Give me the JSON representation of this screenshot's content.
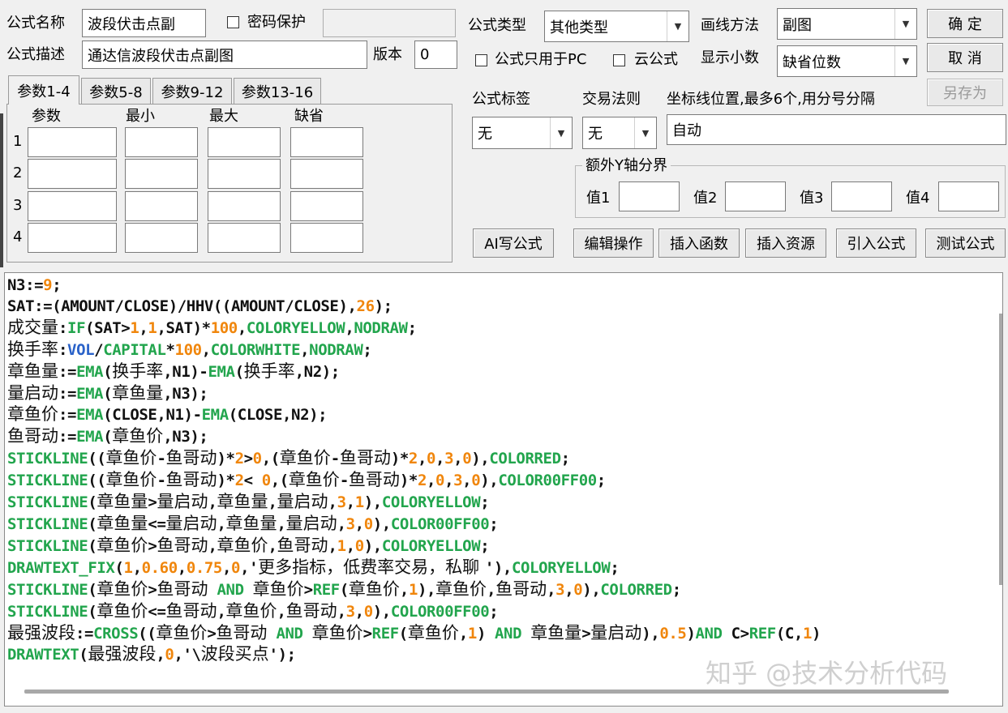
{
  "formula": {
    "name_label": "公式名称",
    "name_value": "波段伏击点副",
    "password_label": "密码保护",
    "desc_label": "公式描述",
    "desc_value": "通达信波段伏击点副图",
    "version_label": "版本",
    "version_value": "0",
    "type_label": "公式类型",
    "type_value": "其他类型",
    "draw_label": "画线方法",
    "draw_value": "副图",
    "pc_only_label": "公式只用于PC",
    "cloud_label": "云公式",
    "decimal_label": "显示小数",
    "decimal_value": "缺省位数",
    "tag_label": "公式标签",
    "tag_value": "无",
    "rule_label": "交易法则",
    "rule_value": "无",
    "coord_label": "坐标线位置,最多6个,用分号分隔",
    "coord_value": "自动",
    "y_group_label": "额外Y轴分界",
    "y_values": [
      "值1",
      "值2",
      "值3",
      "值4"
    ]
  },
  "buttons": {
    "ok": "确  定",
    "cancel": "取  消",
    "save_as": "另存为",
    "ai": "AI写公式",
    "edit": "编辑操作",
    "insert_func": "插入函数",
    "insert_res": "插入资源",
    "import": "引入公式",
    "test": "测试公式"
  },
  "tabs": [
    "参数1-4",
    "参数5-8",
    "参数9-12",
    "参数13-16"
  ],
  "params": {
    "headers": [
      "参数",
      "最小",
      "最大",
      "缺省"
    ],
    "rows": [
      "1",
      "2",
      "3",
      "4"
    ]
  },
  "watermark": "知乎 @技术分析代码",
  "colors": {
    "keyword": "#22a54d",
    "number": "#f0860c",
    "variable": "#2a62c9",
    "text": "#111111"
  },
  "code_lines": [
    [
      [
        "d",
        "N3:="
      ],
      [
        "o",
        "9"
      ],
      [
        "d",
        ";"
      ]
    ],
    [
      [
        "d",
        "SAT:=(AMOUNT/CLOSE)/HHV((AMOUNT/CLOSE),"
      ],
      [
        "o",
        "26"
      ],
      [
        "d",
        ");"
      ]
    ],
    [
      [
        "c",
        "成交量"
      ],
      [
        "d",
        ":"
      ],
      [
        "g",
        "IF"
      ],
      [
        "d",
        "(SAT>"
      ],
      [
        "o",
        "1"
      ],
      [
        "d",
        ","
      ],
      [
        "o",
        "1"
      ],
      [
        "d",
        ",SAT)*"
      ],
      [
        "o",
        "100"
      ],
      [
        "d",
        ","
      ],
      [
        "g",
        "COLORYELLOW"
      ],
      [
        "d",
        ","
      ],
      [
        "g",
        "NODRAW"
      ],
      [
        "d",
        ";"
      ]
    ],
    [
      [
        "c",
        "换手率"
      ],
      [
        "d",
        ":"
      ],
      [
        "b",
        "VOL"
      ],
      [
        "d",
        "/"
      ],
      [
        "g",
        "CAPITAL"
      ],
      [
        "d",
        "*"
      ],
      [
        "o",
        "100"
      ],
      [
        "d",
        ","
      ],
      [
        "g",
        "COLORWHITE"
      ],
      [
        "d",
        ","
      ],
      [
        "g",
        "NODRAW"
      ],
      [
        "d",
        ";"
      ]
    ],
    [
      [
        "c",
        "章鱼量"
      ],
      [
        "d",
        ":="
      ],
      [
        "g",
        "EMA"
      ],
      [
        "d",
        "("
      ],
      [
        "c",
        "换手率"
      ],
      [
        "d",
        ",N1)-"
      ],
      [
        "g",
        "EMA"
      ],
      [
        "d",
        "("
      ],
      [
        "c",
        "换手率"
      ],
      [
        "d",
        ",N2);"
      ]
    ],
    [
      [
        "c",
        "量启动"
      ],
      [
        "d",
        ":="
      ],
      [
        "g",
        "EMA"
      ],
      [
        "d",
        "("
      ],
      [
        "c",
        "章鱼量"
      ],
      [
        "d",
        ",N3);"
      ]
    ],
    [
      [
        "c",
        "章鱼价"
      ],
      [
        "d",
        ":="
      ],
      [
        "g",
        "EMA"
      ],
      [
        "d",
        "(CLOSE,N1)-"
      ],
      [
        "g",
        "EMA"
      ],
      [
        "d",
        "(CLOSE,N2);"
      ]
    ],
    [
      [
        "c",
        "鱼哥动"
      ],
      [
        "d",
        ":="
      ],
      [
        "g",
        "EMA"
      ],
      [
        "d",
        "("
      ],
      [
        "c",
        "章鱼价"
      ],
      [
        "d",
        ",N3);"
      ]
    ],
    [
      [
        "g",
        "STICKLINE"
      ],
      [
        "d",
        "(("
      ],
      [
        "c",
        "章鱼价"
      ],
      [
        "d",
        "-"
      ],
      [
        "c",
        "鱼哥动"
      ],
      [
        "d",
        ")*"
      ],
      [
        "o",
        "2"
      ],
      [
        "d",
        ">"
      ],
      [
        "o",
        "0"
      ],
      [
        "d",
        ",("
      ],
      [
        "c",
        "章鱼价"
      ],
      [
        "d",
        "-"
      ],
      [
        "c",
        "鱼哥动"
      ],
      [
        "d",
        ")*"
      ],
      [
        "o",
        "2"
      ],
      [
        "d",
        ","
      ],
      [
        "o",
        "0"
      ],
      [
        "d",
        ","
      ],
      [
        "o",
        "3"
      ],
      [
        "d",
        ","
      ],
      [
        "o",
        "0"
      ],
      [
        "d",
        "),"
      ],
      [
        "g",
        "COLORRED"
      ],
      [
        "d",
        ";"
      ]
    ],
    [
      [
        "g",
        "STICKLINE"
      ],
      [
        "d",
        "(("
      ],
      [
        "c",
        "章鱼价"
      ],
      [
        "d",
        "-"
      ],
      [
        "c",
        "鱼哥动"
      ],
      [
        "d",
        ")*"
      ],
      [
        "o",
        "2"
      ],
      [
        "d",
        "< "
      ],
      [
        "o",
        "0"
      ],
      [
        "d",
        ",("
      ],
      [
        "c",
        "章鱼价"
      ],
      [
        "d",
        "-"
      ],
      [
        "c",
        "鱼哥动"
      ],
      [
        "d",
        ")*"
      ],
      [
        "o",
        "2"
      ],
      [
        "d",
        ","
      ],
      [
        "o",
        "0"
      ],
      [
        "d",
        ","
      ],
      [
        "o",
        "3"
      ],
      [
        "d",
        ","
      ],
      [
        "o",
        "0"
      ],
      [
        "d",
        "),"
      ],
      [
        "g",
        "COLOR00FF00"
      ],
      [
        "d",
        ";"
      ]
    ],
    [
      [
        "g",
        "STICKLINE"
      ],
      [
        "d",
        "("
      ],
      [
        "c",
        "章鱼量"
      ],
      [
        "d",
        ">"
      ],
      [
        "c",
        "量启动"
      ],
      [
        "d",
        ","
      ],
      [
        "c",
        "章鱼量"
      ],
      [
        "d",
        ","
      ],
      [
        "c",
        "量启动"
      ],
      [
        "d",
        ","
      ],
      [
        "o",
        "3"
      ],
      [
        "d",
        ","
      ],
      [
        "o",
        "1"
      ],
      [
        "d",
        "),"
      ],
      [
        "g",
        "COLORYELLOW"
      ],
      [
        "d",
        ";"
      ]
    ],
    [
      [
        "g",
        "STICKLINE"
      ],
      [
        "d",
        "("
      ],
      [
        "c",
        "章鱼量"
      ],
      [
        "d",
        "<="
      ],
      [
        "c",
        "量启动"
      ],
      [
        "d",
        ","
      ],
      [
        "c",
        "章鱼量"
      ],
      [
        "d",
        ","
      ],
      [
        "c",
        "量启动"
      ],
      [
        "d",
        ","
      ],
      [
        "o",
        "3"
      ],
      [
        "d",
        ","
      ],
      [
        "o",
        "0"
      ],
      [
        "d",
        "),"
      ],
      [
        "g",
        "COLOR00FF00"
      ],
      [
        "d",
        ";"
      ]
    ],
    [
      [
        "g",
        "STICKLINE"
      ],
      [
        "d",
        "("
      ],
      [
        "c",
        "章鱼价"
      ],
      [
        "d",
        ">"
      ],
      [
        "c",
        "鱼哥动"
      ],
      [
        "d",
        ","
      ],
      [
        "c",
        "章鱼价"
      ],
      [
        "d",
        ","
      ],
      [
        "c",
        "鱼哥动"
      ],
      [
        "d",
        ","
      ],
      [
        "o",
        "1"
      ],
      [
        "d",
        ","
      ],
      [
        "o",
        "0"
      ],
      [
        "d",
        "),"
      ],
      [
        "g",
        "COLORYELLOW"
      ],
      [
        "d",
        ";"
      ]
    ],
    [
      [
        "g",
        "DRAWTEXT_FIX"
      ],
      [
        "d",
        "("
      ],
      [
        "o",
        "1"
      ],
      [
        "d",
        ","
      ],
      [
        "o",
        "0.60"
      ],
      [
        "d",
        ","
      ],
      [
        "o",
        "0.75"
      ],
      [
        "d",
        ","
      ],
      [
        "o",
        "0"
      ],
      [
        "d",
        ",'"
      ],
      [
        "c",
        "更多指标，低费率交易，私聊 "
      ],
      [
        "d",
        "'),"
      ],
      [
        "g",
        "COLORYELLOW"
      ],
      [
        "d",
        ";"
      ]
    ],
    [
      [
        "g",
        "STICKLINE"
      ],
      [
        "d",
        "("
      ],
      [
        "c",
        "章鱼价"
      ],
      [
        "d",
        ">"
      ],
      [
        "c",
        "鱼哥动"
      ],
      [
        "d",
        " "
      ],
      [
        "g",
        "AND"
      ],
      [
        "d",
        " "
      ],
      [
        "c",
        "章鱼价"
      ],
      [
        "d",
        ">"
      ],
      [
        "g",
        "REF"
      ],
      [
        "d",
        "("
      ],
      [
        "c",
        "章鱼价"
      ],
      [
        "d",
        ","
      ],
      [
        "o",
        "1"
      ],
      [
        "d",
        "),"
      ],
      [
        "c",
        "章鱼价"
      ],
      [
        "d",
        ","
      ],
      [
        "c",
        "鱼哥动"
      ],
      [
        "d",
        ","
      ],
      [
        "o",
        "3"
      ],
      [
        "d",
        ","
      ],
      [
        "o",
        "0"
      ],
      [
        "d",
        "),"
      ],
      [
        "g",
        "COLORRED"
      ],
      [
        "d",
        ";"
      ]
    ],
    [
      [
        "g",
        "STICKLINE"
      ],
      [
        "d",
        "("
      ],
      [
        "c",
        "章鱼价"
      ],
      [
        "d",
        "<="
      ],
      [
        "c",
        "鱼哥动"
      ],
      [
        "d",
        ","
      ],
      [
        "c",
        "章鱼价"
      ],
      [
        "d",
        ","
      ],
      [
        "c",
        "鱼哥动"
      ],
      [
        "d",
        ","
      ],
      [
        "o",
        "3"
      ],
      [
        "d",
        ","
      ],
      [
        "o",
        "0"
      ],
      [
        "d",
        "),"
      ],
      [
        "g",
        "COLOR00FF00"
      ],
      [
        "d",
        ";"
      ]
    ],
    [
      [
        "c",
        "最强波段"
      ],
      [
        "d",
        ":="
      ],
      [
        "g",
        "CROSS"
      ],
      [
        "d",
        "(("
      ],
      [
        "c",
        "章鱼价"
      ],
      [
        "d",
        ">"
      ],
      [
        "c",
        "鱼哥动"
      ],
      [
        "d",
        " "
      ],
      [
        "g",
        "AND"
      ],
      [
        "d",
        " "
      ],
      [
        "c",
        "章鱼价"
      ],
      [
        "d",
        ">"
      ],
      [
        "g",
        "REF"
      ],
      [
        "d",
        "("
      ],
      [
        "c",
        "章鱼价"
      ],
      [
        "d",
        ","
      ],
      [
        "o",
        "1"
      ],
      [
        "d",
        ") "
      ],
      [
        "g",
        "AND"
      ],
      [
        "d",
        " "
      ],
      [
        "c",
        "章鱼量"
      ],
      [
        "d",
        ">"
      ],
      [
        "c",
        "量启动"
      ],
      [
        "d",
        "),"
      ],
      [
        "o",
        "0.5"
      ],
      [
        "d",
        ")"
      ],
      [
        "g",
        "AND"
      ],
      [
        "d",
        " C>"
      ],
      [
        "g",
        "REF"
      ],
      [
        "d",
        "(C,"
      ],
      [
        "o",
        "1"
      ],
      [
        "d",
        ")"
      ]
    ],
    [
      [
        "g",
        "DRAWTEXT"
      ],
      [
        "d",
        "("
      ],
      [
        "c",
        "最强波段"
      ],
      [
        "d",
        ","
      ],
      [
        "o",
        "0"
      ],
      [
        "d",
        ",'\\"
      ],
      [
        "c",
        "波段买点"
      ],
      [
        "d",
        "');"
      ]
    ]
  ]
}
